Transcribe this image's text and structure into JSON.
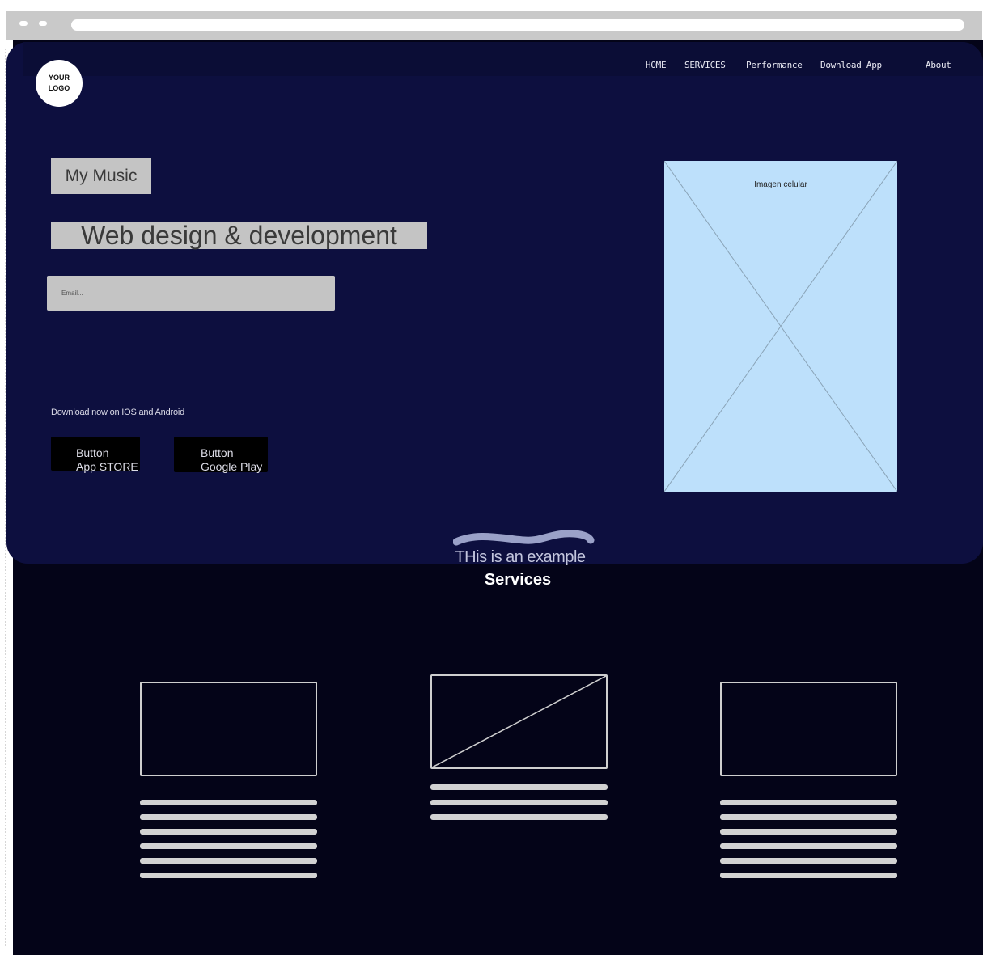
{
  "logo": {
    "line1": "YOUR",
    "line2": "LOGO"
  },
  "nav": {
    "items": [
      {
        "label": "HOME"
      },
      {
        "label": "SERVICES"
      },
      {
        "label": "Performance"
      },
      {
        "label": "Download App"
      },
      {
        "label": "About"
      }
    ]
  },
  "hero": {
    "tag": "My Music",
    "title": "Web design & development",
    "email_placeholder": "Email...",
    "download_text": "Download now on IOS and Android",
    "app_store": {
      "line1": "Button",
      "line2": "App STORE"
    },
    "google_play": {
      "line1": "Button",
      "line2": "Google Play"
    },
    "phone_label": "Imagen celular"
  },
  "services": {
    "subtitle": "THis is an example",
    "title": "Services"
  },
  "colors": {
    "hero_bg": "#0d0f3f",
    "page_bg": "#040418",
    "placeholder_gray": "#c4c4c4",
    "phone_placeholder": "#bde0fb"
  }
}
